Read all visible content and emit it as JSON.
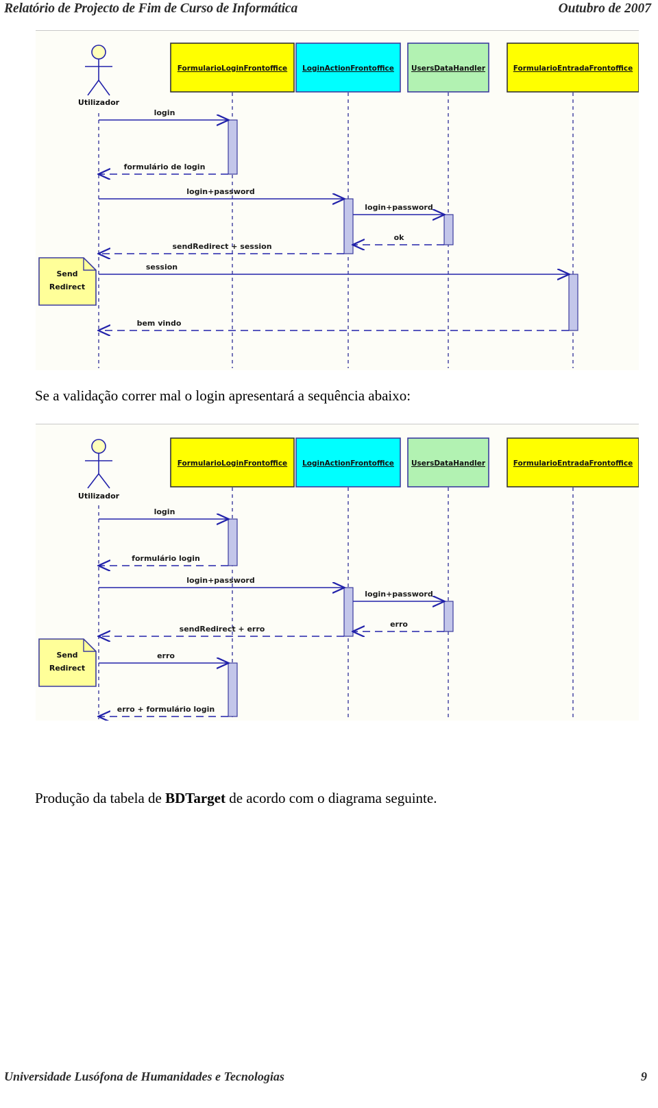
{
  "header": {
    "left": "Relatório de Projecto de Fim de Curso de Informática",
    "right": "Outubro de 2007"
  },
  "footer": {
    "institution": "Universidade Lusófona de Humanidades e Tecnologias",
    "page_number": "9"
  },
  "paragraphs": {
    "p1": "Se a validação correr mal o login apresentará a sequência abaixo:",
    "p2_before": "Produção da tabela de ",
    "p2_bold": "BDTarget",
    "p2_after": " de acordo com o diagrama seguinte."
  },
  "colors": {
    "yellow_box": "#ffff00",
    "cyan_box": "#00ffff",
    "green_box": "#b2f2b2",
    "note_yellow": "#ffff99",
    "line_blue": "#2222aa",
    "activation_fill": "#c3c6ea",
    "diagram_bg": "#fdfdf7"
  },
  "diagram1": {
    "name": "login-success-sequence-diagram",
    "actor": {
      "label": "Utilizador"
    },
    "lifelines": [
      {
        "label": "FormularioLoginFrontoffice",
        "color": "#ffff00"
      },
      {
        "label": "LoginActionFrontoffice",
        "color": "#00ffff"
      },
      {
        "label": "UsersDataHandler",
        "color": "#b2f2b2"
      },
      {
        "label": "FormularioEntradaFrontoffice",
        "color": "#ffff00"
      }
    ],
    "note": {
      "line1": "Send",
      "line2": "Redirect"
    },
    "messages": [
      {
        "label": "login",
        "style": "solid",
        "direction": "right"
      },
      {
        "label": "formulário de login",
        "style": "dashed",
        "direction": "left"
      },
      {
        "label": "login+password",
        "style": "solid",
        "direction": "right"
      },
      {
        "label": "login+password",
        "style": "solid",
        "direction": "right"
      },
      {
        "label": "ok",
        "style": "dashed",
        "direction": "left"
      },
      {
        "label": "sendRedirect + session",
        "style": "dashed",
        "direction": "left"
      },
      {
        "label": "session",
        "style": "solid",
        "direction": "right"
      },
      {
        "label": "bem vindo",
        "style": "dashed",
        "direction": "left"
      }
    ]
  },
  "diagram2": {
    "name": "login-failure-sequence-diagram",
    "actor": {
      "label": "Utilizador"
    },
    "lifelines": [
      {
        "label": "FormularioLoginFrontoffice",
        "color": "#ffff00"
      },
      {
        "label": "LoginActionFrontoffice",
        "color": "#00ffff"
      },
      {
        "label": "UsersDataHandler",
        "color": "#b2f2b2"
      },
      {
        "label": "FormularioEntradaFrontoffice",
        "color": "#ffff00"
      }
    ],
    "note": {
      "line1": "Send",
      "line2": "Redirect"
    },
    "messages": [
      {
        "label": "login",
        "style": "solid",
        "direction": "right"
      },
      {
        "label": "formulário login",
        "style": "dashed",
        "direction": "left"
      },
      {
        "label": "login+password",
        "style": "solid",
        "direction": "right"
      },
      {
        "label": "login+password",
        "style": "solid",
        "direction": "right"
      },
      {
        "label": "erro",
        "style": "dashed",
        "direction": "left"
      },
      {
        "label": "sendRedirect + erro",
        "style": "dashed",
        "direction": "left"
      },
      {
        "label": "erro",
        "style": "solid",
        "direction": "right"
      },
      {
        "label": "erro + formulário login",
        "style": "dashed",
        "direction": "left"
      }
    ]
  }
}
